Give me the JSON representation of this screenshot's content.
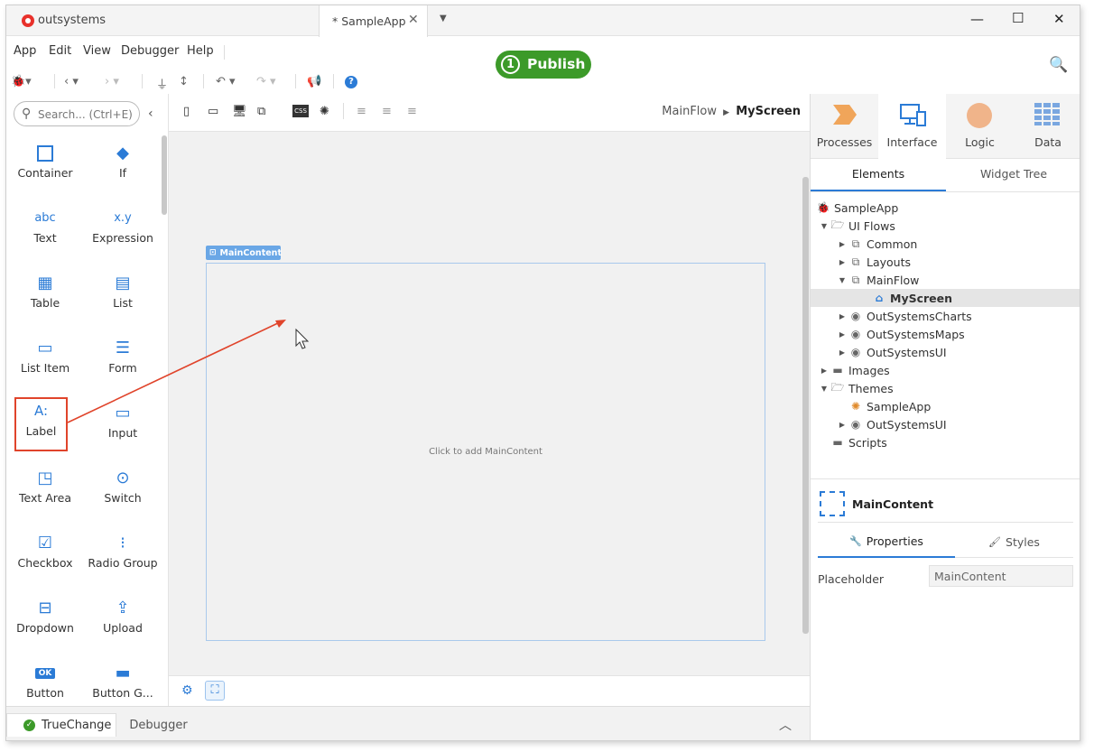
{
  "app": {
    "logo_text": "outsystems",
    "tab_title": "* SampleApp",
    "brand_color": "#e8312b"
  },
  "menu": [
    "App",
    "Edit",
    "View",
    "Debugger",
    "Help"
  ],
  "publish": {
    "count": "1",
    "label": "Publish",
    "color": "#3c9a29"
  },
  "search": {
    "placeholder": "Search... (Ctrl+E)"
  },
  "toolbox": [
    {
      "label": "Container",
      "icon": "container-icon"
    },
    {
      "label": "If",
      "icon": "if-diamond-icon"
    },
    {
      "label": "Text",
      "icon": "abc"
    },
    {
      "label": "Expression",
      "icon": "x.y"
    },
    {
      "label": "Table",
      "icon": "table-icon"
    },
    {
      "label": "List",
      "icon": "list-icon"
    },
    {
      "label": "List Item",
      "icon": "list-item-icon"
    },
    {
      "label": "Form",
      "icon": "form-icon"
    },
    {
      "label": "Label",
      "icon": "A:"
    },
    {
      "label": "Input",
      "icon": "input-icon"
    },
    {
      "label": "Text Area",
      "icon": "text-area-icon"
    },
    {
      "label": "Switch",
      "icon": "switch-icon"
    },
    {
      "label": "Checkbox",
      "icon": "checkbox-icon"
    },
    {
      "label": "Radio Group",
      "icon": "radio-group-icon"
    },
    {
      "label": "Dropdown",
      "icon": "dropdown-icon"
    },
    {
      "label": "Upload",
      "icon": "upload-icon"
    },
    {
      "label": "Button",
      "icon": "OK"
    },
    {
      "label": "Button G...",
      "icon": "button-group-icon"
    }
  ],
  "breadcrumb": {
    "parent": "MainFlow",
    "current": "MyScreen"
  },
  "canvas": {
    "placeholder_tag": "MainContent",
    "placeholder_text": "Click to add MainContent"
  },
  "bottom_tabs": [
    "TrueChange",
    "Debugger"
  ],
  "right_tabs": [
    "Processes",
    "Interface",
    "Logic",
    "Data"
  ],
  "sub_tabs": [
    "Elements",
    "Widget Tree"
  ],
  "tree": [
    {
      "label": "SampleApp"
    },
    {
      "label": "UI Flows"
    },
    {
      "label": "Common"
    },
    {
      "label": "Layouts"
    },
    {
      "label": "MainFlow"
    },
    {
      "label": "MyScreen"
    },
    {
      "label": "OutSystemsCharts"
    },
    {
      "label": "OutSystemsMaps"
    },
    {
      "label": "OutSystemsUI"
    },
    {
      "label": "Images"
    },
    {
      "label": "Themes"
    },
    {
      "label": "SampleApp"
    },
    {
      "label": "OutSystemsUI"
    },
    {
      "label": "Scripts"
    }
  ],
  "properties": {
    "title": "MainContent",
    "tabs": [
      "Properties",
      "Styles"
    ],
    "placeholder_label": "Placeholder",
    "placeholder_value": "MainContent"
  }
}
